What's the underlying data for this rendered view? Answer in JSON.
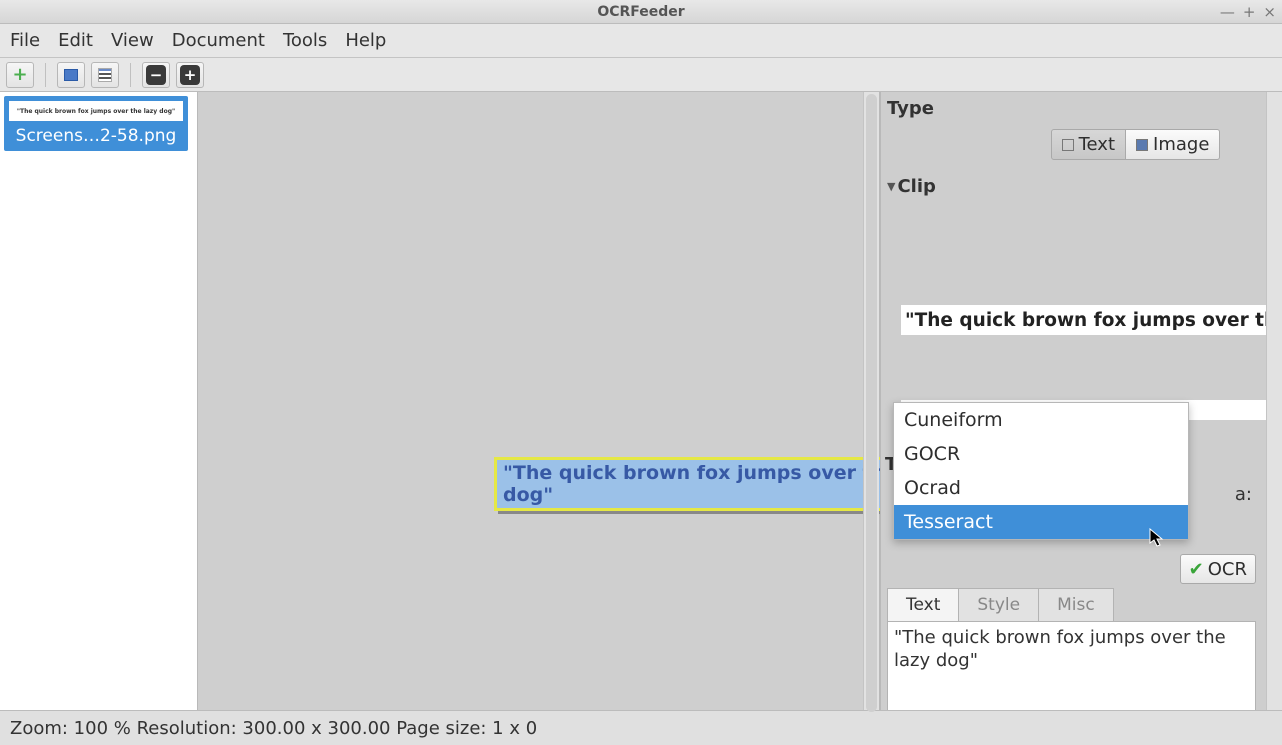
{
  "window": {
    "title": "OCRFeeder"
  },
  "menu": {
    "file": "File",
    "edit": "Edit",
    "view": "View",
    "document": "Document",
    "tools": "Tools",
    "help": "Help"
  },
  "sidebar": {
    "thumb_label": "Screens…2-58.png",
    "thumb_preview_text": "\"The quick brown fox jumps over the lazy dog\""
  },
  "canvas": {
    "region_text": "\"The quick brown fox jumps over the lazy dog\""
  },
  "rpanel": {
    "type_header": "Type",
    "type_text": "Text",
    "type_image": "Image",
    "clip_header": "Clip",
    "clip_preview": "\"The quick brown fox jumps over the",
    "text_partial_label": "T",
    "area_partial_label": "a:",
    "ocr_button": "OCR",
    "tabs": {
      "text": "Text",
      "style": "Style",
      "misc": "Misc"
    },
    "output_text": "\"The quick brown fox jumps over the lazy dog\"",
    "engine_options": [
      "Cuneiform",
      "GOCR",
      "Ocrad",
      "Tesseract"
    ],
    "engine_selected": "Tesseract"
  },
  "statusbar": {
    "text": "Zoom: 100 % Resolution: 300.00 x 300.00 Page size: 1 x 0"
  }
}
